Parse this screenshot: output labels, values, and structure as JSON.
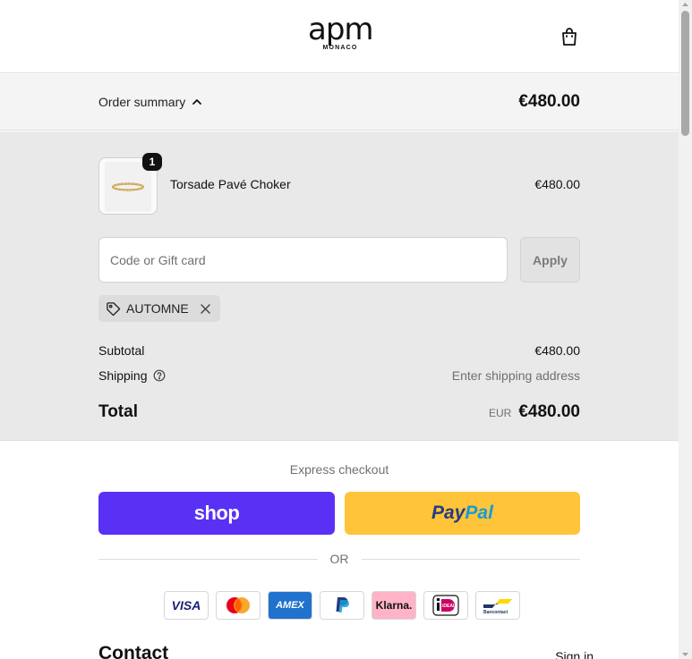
{
  "header": {
    "logo_main": "apm",
    "logo_sub": "MONACO"
  },
  "summary": {
    "label": "Order summary",
    "total": "€480.00"
  },
  "item": {
    "quantity": "1",
    "name": "Torsade Pavé Choker",
    "price": "€480.00"
  },
  "discount": {
    "placeholder": "Code or Gift card",
    "apply_label": "Apply",
    "applied_code": "AUTOMNE"
  },
  "totals": {
    "subtotal_label": "Subtotal",
    "subtotal_value": "€480.00",
    "shipping_label": "Shipping",
    "shipping_value": "Enter shipping address",
    "total_label": "Total",
    "currency": "EUR",
    "total_value": "€480.00"
  },
  "express": {
    "title": "Express checkout",
    "shop_label": "shop",
    "paypal_part1": "Pay",
    "paypal_part2": "Pal",
    "or_label": "OR"
  },
  "payment_methods": [
    {
      "name": "VISA",
      "color": "#1a1f71",
      "bg": "#ffffff"
    },
    {
      "name": "mastercard",
      "color": "#eb001b",
      "bg": "#ffffff"
    },
    {
      "name": "AMEX",
      "color": "#ffffff",
      "bg": "#1f72cd"
    },
    {
      "name": "PayPal",
      "color": "#253b80",
      "bg": "#ffffff"
    },
    {
      "name": "Klarna.",
      "color": "#111111",
      "bg": "#ffb3c7"
    },
    {
      "name": "iDEAL",
      "color": "#cc0066",
      "bg": "#ffffff"
    },
    {
      "name": "Bancontact",
      "color": "#1e3764",
      "bg": "#ffffff"
    }
  ],
  "contact": {
    "title": "Contact",
    "signin_label": "Sign in"
  },
  "colors": {
    "shop_pay": "#5a31f4",
    "paypal_yellow": "#ffc439",
    "summary_bg": "#e9e9e9"
  }
}
